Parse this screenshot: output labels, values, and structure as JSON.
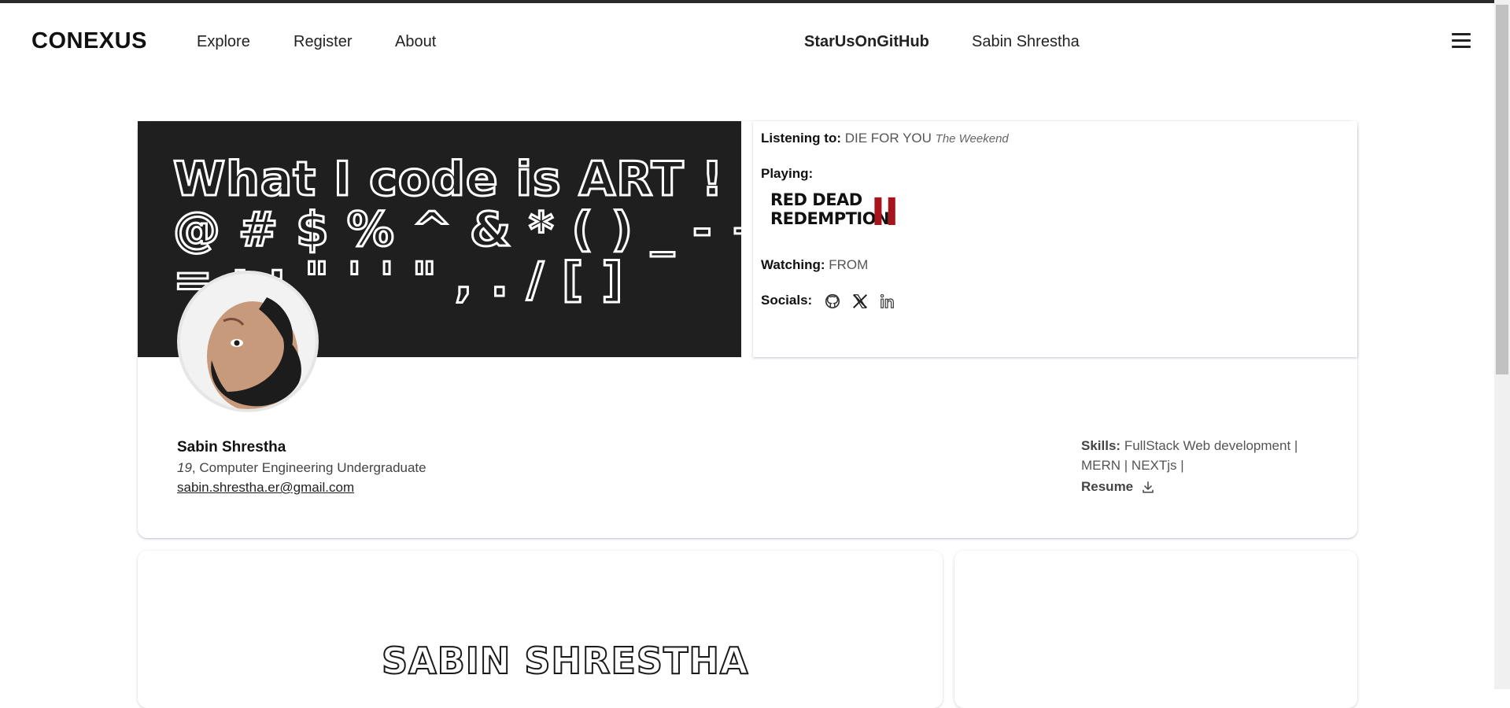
{
  "header": {
    "brand": "CONEXUS",
    "nav": [
      "Explore",
      "Register",
      "About"
    ],
    "star_link": "StarUsOnGitHub",
    "user_name": "Sabin Shrestha"
  },
  "banner": {
    "lines": [
      "What I code is ART !",
      "@ # $ % ^ & * ( ) _ - +",
      "= ; : \" ' ' \" , . / [ ]"
    ]
  },
  "status": {
    "listening_label": "Listening to:",
    "listening_song": "DIE FOR YOU",
    "listening_artist": "The Weekend",
    "playing_label": "Playing:",
    "game_logo_line1": "RED DEAD",
    "game_logo_line2": "REDEMPTION",
    "game_logo_numeral": "II",
    "watching_label": "Watching:",
    "watching_value": "FROM",
    "socials_label": "Socials:",
    "social_icons": [
      "github-icon",
      "x-icon",
      "linkedin-icon"
    ]
  },
  "profile": {
    "name": "Sabin Shrestha",
    "age": "19",
    "title": ", Computer Engineering Undergraduate",
    "email": "sabin.shrestha.er@gmail.com",
    "skills_label": "Skills:",
    "skills_value": "FullStack Web development | MERN | NEXTjs |",
    "resume_label": "Resume"
  },
  "lower": {
    "big_name": "SABIN SHRESTHA"
  },
  "colors": {
    "banner_bg": "#1f1f1f",
    "accent_red": "#a8141c"
  }
}
